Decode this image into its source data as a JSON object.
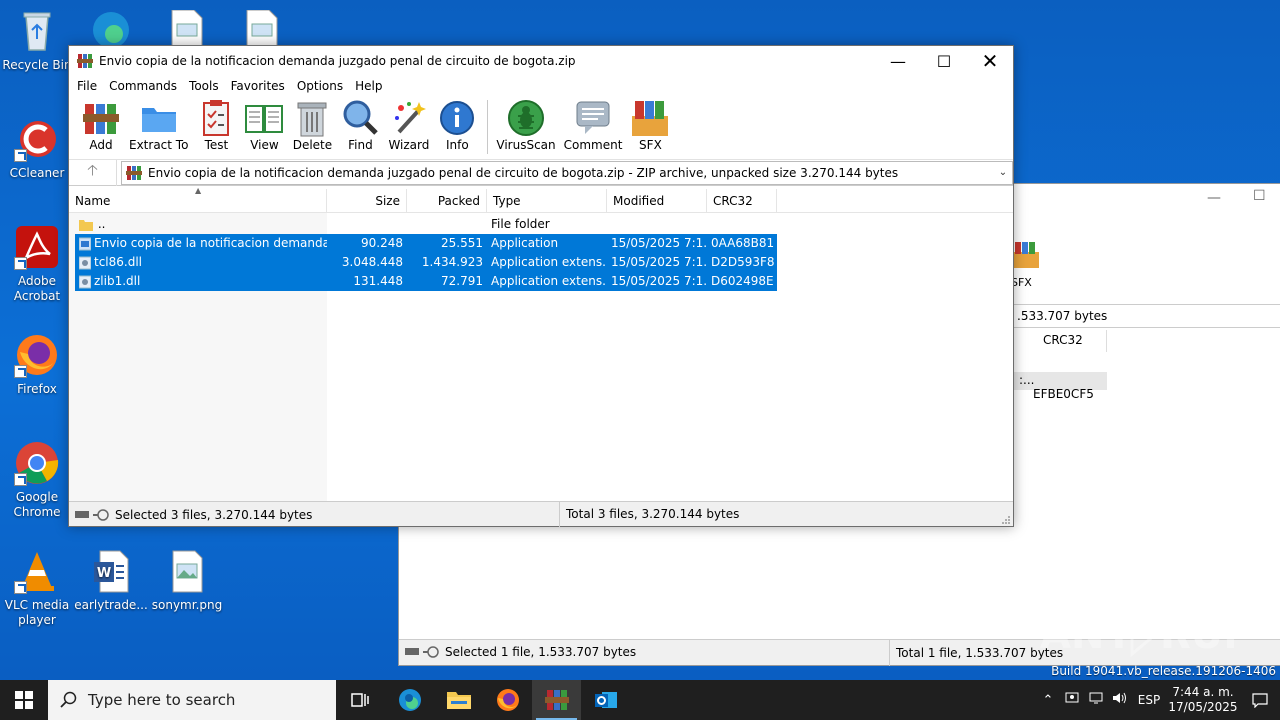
{
  "window": {
    "title": "Envio copia de la notificacion demanda juzgado penal de circuito de bogota.zip",
    "menu": [
      "File",
      "Commands",
      "Tools",
      "Favorites",
      "Options",
      "Help"
    ],
    "toolbar": [
      "Add",
      "Extract To",
      "Test",
      "View",
      "Delete",
      "Find",
      "Wizard",
      "Info",
      "VirusScan",
      "Comment",
      "SFX"
    ],
    "address": "Envio copia de la notificacion demanda juzgado penal de circuito de bogota.zip - ZIP archive, unpacked size 3.270.144 bytes",
    "columns": {
      "name": "Name",
      "size": "Size",
      "packed": "Packed",
      "type": "Type",
      "modified": "Modified",
      "crc": "CRC32"
    },
    "parent_row": {
      "name": "..",
      "type": "File folder"
    },
    "rows": [
      {
        "name": "Envio copia de la notificacion demanda ju...",
        "size": "90.248",
        "packed": "25.551",
        "type": "Application",
        "modified": "15/05/2025 7:1...",
        "crc": "0AA68B81"
      },
      {
        "name": "tcl86.dll",
        "size": "3.048.448",
        "packed": "1.434.923",
        "type": "Application extens...",
        "modified": "15/05/2025 7:1...",
        "crc": "D2D593F8"
      },
      {
        "name": "zlib1.dll",
        "size": "131.448",
        "packed": "72.791",
        "type": "Application extens...",
        "modified": "15/05/2025 7:1...",
        "crc": "D602498E"
      }
    ],
    "status_left": "Selected 3 files, 3.270.144 bytes",
    "status_right": "Total 3 files, 3.270.144 bytes"
  },
  "bg_window": {
    "sfx": "SFX",
    "path_tail": ".533.707 bytes",
    "crc_header": "CRC32",
    "crc_prefix": ":...",
    "crc_value": "EFBE0CF5",
    "status_left": "Selected 1 file, 1.533.707 bytes",
    "status_right": "Total 1 file, 1.533.707 bytes"
  },
  "desktop": {
    "icons": [
      {
        "label": "Recycle Bin"
      },
      {
        "label": "CCleaner"
      },
      {
        "label": "Adobe Acrobat"
      },
      {
        "label": "Firefox"
      },
      {
        "label": "Google Chrome"
      },
      {
        "label": "VLC media player"
      },
      {
        "label": "earlytrade..."
      },
      {
        "label": "sonymr.png"
      }
    ],
    "build": "Build 19041.vb_release.191206-1406"
  },
  "taskbar": {
    "search_placeholder": "Type here to search",
    "lang": "ESP",
    "time": "7:44 a. m.",
    "date": "17/05/2025"
  },
  "colors": {
    "selection": "#0078d7",
    "taskbar": "#1f1f1f",
    "desktop": "#0c6fd6"
  }
}
